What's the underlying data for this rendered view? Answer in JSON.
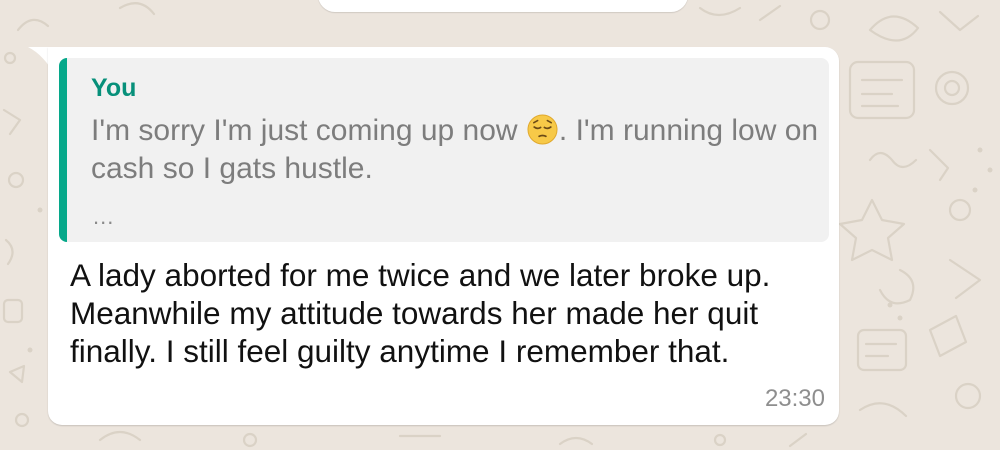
{
  "theme": {
    "background": "#ece5dd",
    "bubble": "#ffffff",
    "quote_background": "#f1f1f1",
    "quote_accent": "#06a88a",
    "quote_author_color": "#07907a"
  },
  "message": {
    "quote": {
      "author": "You",
      "text_before_emoji": "I'm sorry I'm just coming up now ",
      "emoji": "pensive-face-icon",
      "text_after_emoji": ". I'm running low on cash so I gats hustle.",
      "ellipsis": "..."
    },
    "text": "A lady aborted for me twice and we later broke up. Meanwhile my attitude towards her made her quit finally. I still feel guilty anytime I remember that.",
    "time": "23:30"
  }
}
